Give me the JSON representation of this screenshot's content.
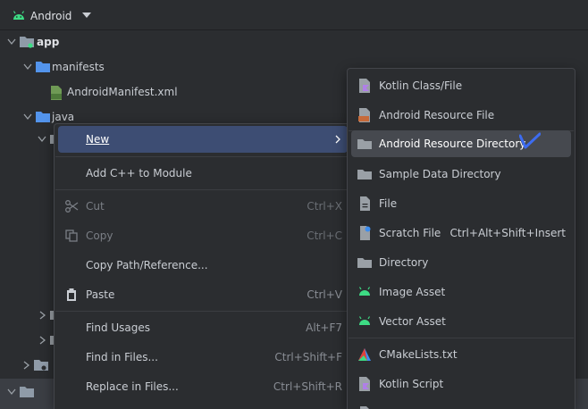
{
  "header": {
    "title": "Android"
  },
  "tree": {
    "app": "app",
    "manifests": "manifests",
    "manifest_file": "AndroidManifest.xml",
    "java": "java"
  },
  "context_menu": {
    "items": [
      {
        "label": "New"
      },
      {
        "label": "Add C++ to Module"
      },
      {
        "label": "Cut",
        "shortcut": "Ctrl+X"
      },
      {
        "label": "Copy",
        "shortcut": "Ctrl+C"
      },
      {
        "label": "Copy Path/Reference..."
      },
      {
        "label": "Paste",
        "shortcut": "Ctrl+V"
      },
      {
        "label": "Find Usages",
        "shortcut": "Alt+F7"
      },
      {
        "label": "Find in Files...",
        "shortcut": "Ctrl+Shift+F"
      },
      {
        "label": "Replace in Files...",
        "shortcut": "Ctrl+Shift+R"
      }
    ]
  },
  "submenu": {
    "items": [
      {
        "label": "Kotlin Class/File"
      },
      {
        "label": "Android Resource File"
      },
      {
        "label": "Android Resource Directory"
      },
      {
        "label": "Sample Data Directory"
      },
      {
        "label": "File"
      },
      {
        "label": "Scratch File",
        "shortcut": "Ctrl+Alt+Shift+Insert"
      },
      {
        "label": "Directory"
      },
      {
        "label": "Image Asset"
      },
      {
        "label": "Vector Asset"
      },
      {
        "label": "CMakeLists.txt"
      },
      {
        "label": "Kotlin Script"
      }
    ]
  },
  "colors": {
    "background": "#2b2d30",
    "highlight": "#3d4d73",
    "folder": "#5394ec",
    "android_green": "#3ddc84"
  }
}
